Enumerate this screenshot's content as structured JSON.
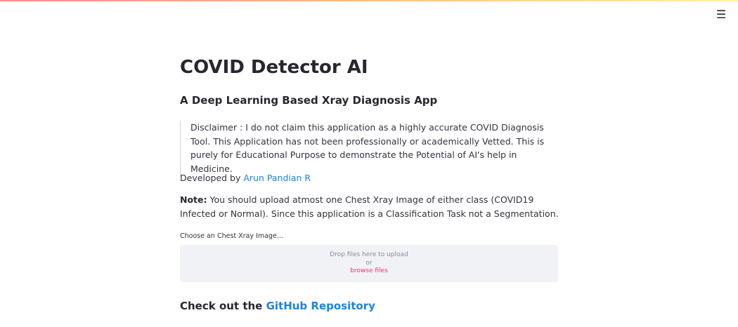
{
  "header": {
    "menu_icon": "hamburger-icon",
    "menu_glyph": "☰",
    "accent_gradient": [
      "#ff8a8a",
      "#ffbf8a",
      "#fff2a8"
    ]
  },
  "main": {
    "title": "COVID Detector AI",
    "subtitle": "A Deep Learning Based Xray Diagnosis App",
    "disclaimer": "Disclaimer : I do not claim this application as a highly accurate COVID Diagnosis Tool. This Application has not been professionally or academically Vetted. This is purely for Educational Purpose to demonstrate the Potential of AI's help in Medicine.",
    "developer_prefix": "Developed by ",
    "developer_link": "Arun Pandian R",
    "note_label": "Note:",
    "note_text": " You should upload atmost one Chest Xray Image of either class (COVID19 Infected or Normal). Since this application is a Classification Task not a Segmentation.",
    "uploader": {
      "label": "Choose an Chest Xray Image...",
      "drop_text": "Drop files here to upload",
      "or_text": "or",
      "browse_text": "browse files"
    },
    "github_prefix": "Check out the ",
    "github_link": "GitHub Repository"
  },
  "colors": {
    "link": "#1c83e1",
    "browse": "#f63366",
    "dropzone_bg": "#f0f2f6",
    "text": "#262730"
  }
}
